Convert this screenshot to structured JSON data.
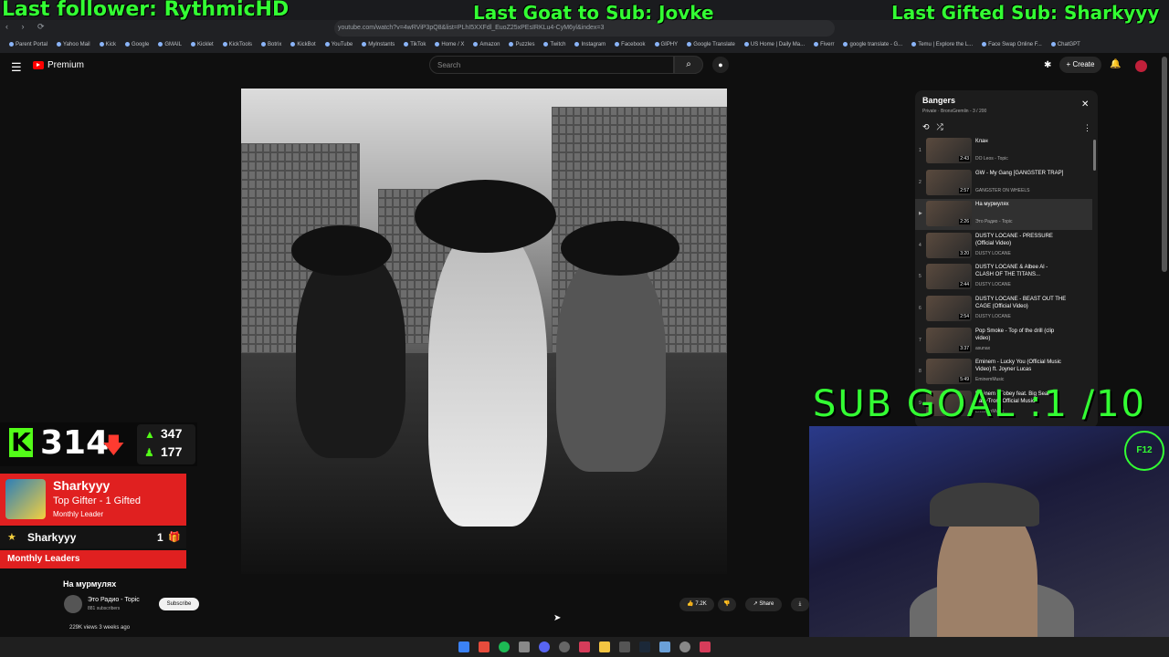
{
  "overlays": {
    "last_follower": "Last follower: RythmicHD",
    "last_goat": "Last Goat to Sub: Jovke",
    "last_gifted": "Last Gifted Sub: Sharkyyy",
    "sub_goal": "SUB GOAL :1 /10"
  },
  "browser": {
    "url": "youtube.com/watch?v=4wRViP3pQ8&list=PLhI5XXFdl_EuoZ25xPEsIRKLu4-CyM6yl&index=3",
    "bookmarks": [
      "Parent Portal",
      "Yahoo Mail",
      "Kick",
      "Google",
      "GMAIL",
      "Kicklet",
      "KickTools",
      "Botrix",
      "KickBot",
      "YouTube",
      "MyInstants",
      "TikTok",
      "Home / X",
      "Amazon",
      "Puzzles",
      "Twitch",
      "Instagram",
      "Facebook",
      "GIPHY",
      "Google Translate",
      "US Home | Daily Ma...",
      "Fiverr",
      "google translate - G...",
      "Temu | Explore the L...",
      "Face Swap Online F...",
      "ChatGPT"
    ]
  },
  "youtube": {
    "logo": "Premium",
    "search_placeholder": "Search",
    "create": "Create"
  },
  "video": {
    "title": "На мурмулях",
    "channel": "Это Радио - Topic",
    "subscribers": "881 subscribers",
    "subscribe": "Subscribe",
    "likes": "7.2K",
    "share": "Share",
    "stats": "229K views  3 weeks ago"
  },
  "playlist": {
    "title": "Bangers",
    "meta": "Private · BronxGremlin - 3 / 200",
    "items": [
      {
        "num": "1",
        "title": "Клан",
        "channel": "DO Leos - Topic",
        "duration": "2:43"
      },
      {
        "num": "2",
        "title": "GW - My Gang [GANGSTER TRAP]",
        "channel": "GANGSTER ON WHEELS",
        "duration": "2:57"
      },
      {
        "num": "▶",
        "title": "На мурмулях",
        "channel": "Это Радио - Topic",
        "duration": "2:26"
      },
      {
        "num": "4",
        "title": "DUSTY LOCANE - PRESSURE (Official Video)",
        "channel": "DUSTY LOCANE",
        "duration": "3:20"
      },
      {
        "num": "5",
        "title": "DUSTY LOCANE & Albee Al - CLASH OF THE TITANS...",
        "channel": "DUSTY LOCANE",
        "duration": "2:44"
      },
      {
        "num": "6",
        "title": "DUSTY LOCANE - BEAST OUT THE CAGE (Official Video)",
        "channel": "DUSTY LOCANE",
        "duration": "2:54"
      },
      {
        "num": "7",
        "title": "Pop Smoke - Top of the drill (clip video)",
        "channel": "asunax",
        "duration": "3:37"
      },
      {
        "num": "8",
        "title": "Eminem - Lucky You (Official Music Video) ft. Joyner Lucas",
        "channel": "EminemMusic",
        "duration": "5:49"
      },
      {
        "num": "9",
        "title": "Eminem - Tobey feat. Big Sean & BabyTron (Official Music...",
        "channel": "EminemMusic",
        "duration": ""
      }
    ]
  },
  "kick": {
    "count": "314",
    "up": "347",
    "down": "177"
  },
  "gifter": {
    "name": "Sharkyyy",
    "line1": "Top Gifter - 1 Gifted",
    "line2": "Monthly Leader",
    "leader_name": "Sharkyyy",
    "leader_count": "1",
    "monthly": "Monthly Leaders"
  },
  "cam_badge": "F12"
}
